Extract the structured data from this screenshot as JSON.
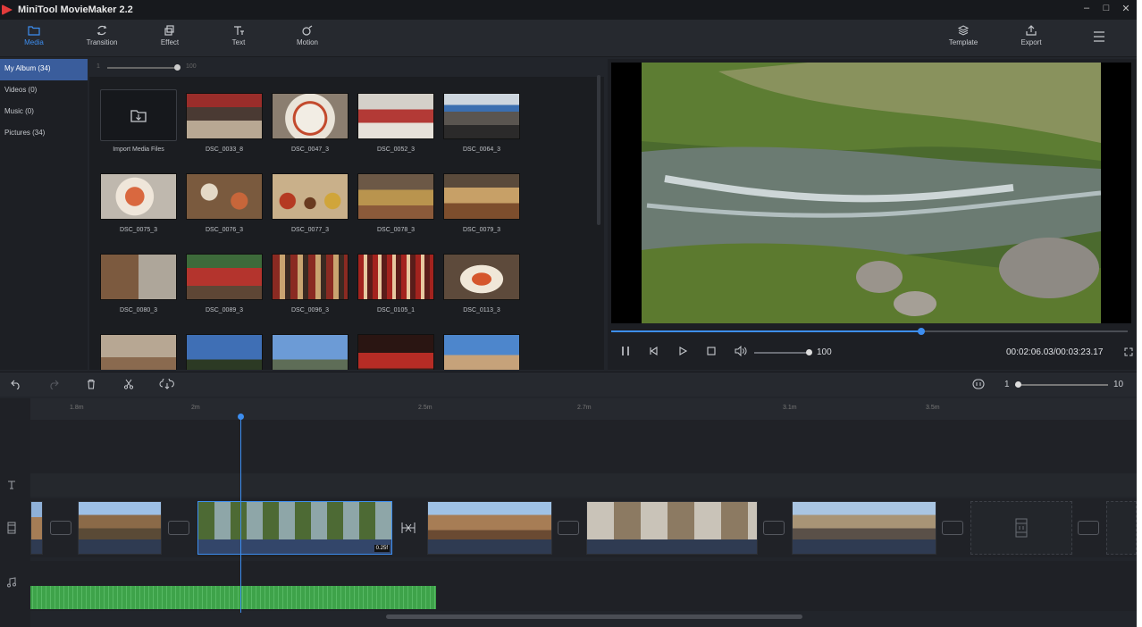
{
  "window": {
    "title": "MiniTool MovieMaker 2.2",
    "controls": [
      "–",
      "□",
      "✕"
    ]
  },
  "toolbar": {
    "tools": [
      {
        "label": "Media",
        "icon": "folder-icon",
        "active": true
      },
      {
        "label": "Transition",
        "icon": "transition-icon",
        "active": false
      },
      {
        "label": "Effect",
        "icon": "effect-icon",
        "active": false
      },
      {
        "label": "Text",
        "icon": "text-icon",
        "active": false
      },
      {
        "label": "Motion",
        "icon": "motion-icon",
        "active": false
      }
    ],
    "right_tools": [
      {
        "label": "Template",
        "icon": "template-icon"
      },
      {
        "label": "Export",
        "icon": "export-icon"
      }
    ],
    "menu_icon": "hamburger-menu-icon"
  },
  "albums": [
    {
      "label": "My Album  (34)",
      "active": true
    },
    {
      "label": "Videos  (0)",
      "active": false
    },
    {
      "label": "Music  (0)",
      "active": false
    },
    {
      "label": "Pictures  (34)",
      "active": false
    }
  ],
  "library": {
    "zoom_min": "1",
    "zoom_max": "100",
    "import_label": "Import Media Files",
    "items": [
      "DSC_0033_8",
      "DSC_0047_3",
      "DSC_0052_3",
      "DSC_0064_3",
      "DSC_0075_3",
      "DSC_0076_3",
      "DSC_0077_3",
      "DSC_0078_3",
      "DSC_0079_3",
      "DSC_0080_3",
      "DSC_0089_3",
      "DSC_0096_3",
      "DSC_0105_1",
      "DSC_0113_3",
      "",
      "",
      "",
      "",
      ""
    ]
  },
  "player": {
    "progress": 0.6,
    "volume": "100",
    "timecode": "00:02:06.03/00:03:23.17"
  },
  "timeline": {
    "ruler": [
      "1.8m",
      "2m",
      "2.5m",
      "2.7m",
      "3.1m",
      "3.5m"
    ],
    "zoom_min": "1",
    "zoom_max": "10",
    "selected_clip_duration": "0.25f"
  },
  "colors": {
    "accent": "#3d8ef0",
    "audio_track": "#3ea34a",
    "active_album": "#3a5d9c"
  }
}
